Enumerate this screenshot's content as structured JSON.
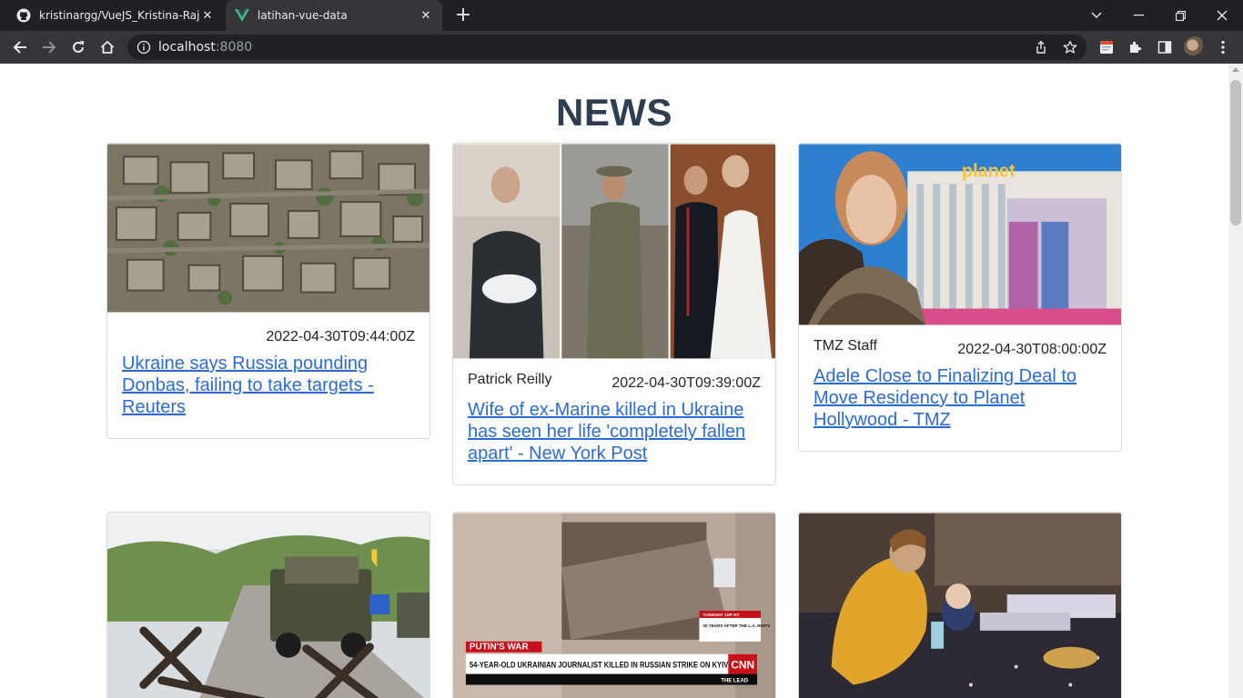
{
  "browser": {
    "tabs": [
      {
        "title": "kristinargg/VueJS_Kristina-Rajagu",
        "icon": "github-icon",
        "active": false
      },
      {
        "title": "latihan-vue-data",
        "icon": "vue-icon",
        "active": true
      }
    ],
    "address": {
      "host": "localhost",
      "port": ":8080"
    }
  },
  "page": {
    "title": "NEWS",
    "articles": [
      {
        "author": "",
        "date": "2022-04-30T09:44:00Z",
        "headline": "Ukraine says Russia pounding Donbas, failing to take targets - Reuters"
      },
      {
        "author": "Patrick Reilly",
        "date": "2022-04-30T09:39:00Z",
        "headline": "Wife of ex-Marine killed in Ukraine has seen her life 'completely fallen apart' - New York Post"
      },
      {
        "author": "TMZ Staff",
        "date": "2022-04-30T08:00:00Z",
        "headline": "Adele Close to Finalizing Deal to Move Residency to Planet Hollywood - TMZ"
      },
      {
        "author": "",
        "date": "",
        "headline": ""
      },
      {
        "author": "",
        "date": "",
        "headline": "",
        "image_text": {
          "banner": "PUTIN'S WAR",
          "ticker": "54-YEAR-OLD UKRAINIAN JOURNALIST KILLED IN RUSSIAN STRIKE ON KYIV",
          "logo": "CNN",
          "show": "THE LEAD",
          "promo": "30 YEARS AFTER THE L.A. RIOTS",
          "promo_time": "TONIGHT 10P ET"
        }
      },
      {
        "author": "",
        "date": "",
        "headline": ""
      }
    ]
  },
  "colors": {
    "title": "#2c3e50",
    "link": "#2a6cd6",
    "chrome_dark": "#202124",
    "chrome_mid": "#35363a"
  }
}
